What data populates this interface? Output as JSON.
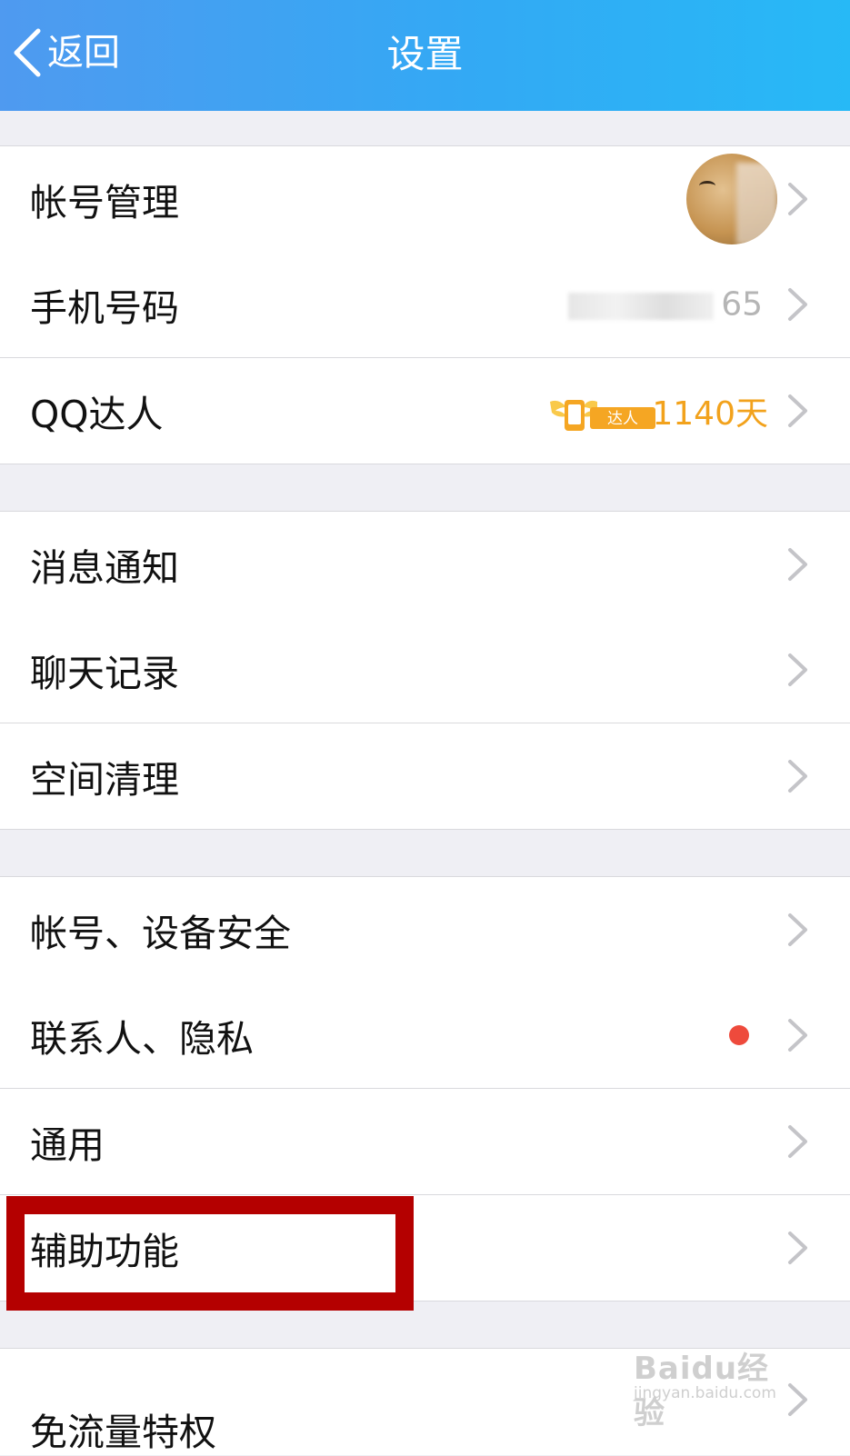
{
  "nav": {
    "back_label": "返回",
    "title": "设置"
  },
  "groups": [
    {
      "items": [
        {
          "label": "帐号管理"
        },
        {
          "label": "手机号码",
          "value": "65"
        },
        {
          "label": "QQ达人",
          "badge": "达人",
          "value": "1140天"
        }
      ]
    },
    {
      "items": [
        {
          "label": "消息通知"
        },
        {
          "label": "聊天记录"
        },
        {
          "label": "空间清理"
        }
      ]
    },
    {
      "items": [
        {
          "label": "帐号、设备安全"
        },
        {
          "label": "联系人、隐私"
        },
        {
          "label": "通用"
        },
        {
          "label": "辅助功能"
        }
      ]
    },
    {
      "items": [
        {
          "label": "免流量特权"
        }
      ]
    }
  ],
  "watermark": {
    "brand": "Baidu经验",
    "url": "jingyan.baidu.com"
  },
  "colors": {
    "nav_gradient_start": "#4f9af0",
    "nav_gradient_end": "#27b9f6",
    "highlight": "#b40000",
    "daren_orange": "#f2a21c",
    "notification_dot": "#ee4a3c"
  }
}
